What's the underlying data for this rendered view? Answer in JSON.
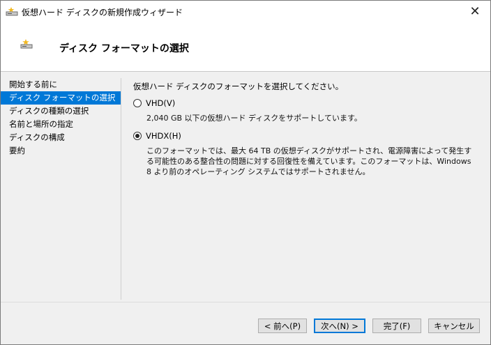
{
  "window": {
    "title": "仮想ハード ディスクの新規作成ウィザード",
    "close_glyph": "✕"
  },
  "header": {
    "title": "ディスク フォーマットの選択"
  },
  "nav": {
    "items": [
      {
        "label": "開始する前に",
        "active": false
      },
      {
        "label": "ディスク フォーマットの選択",
        "active": true
      },
      {
        "label": "ディスクの種類の選択",
        "active": false
      },
      {
        "label": "名前と場所の指定",
        "active": false
      },
      {
        "label": "ディスクの構成",
        "active": false
      },
      {
        "label": "要約",
        "active": false
      }
    ]
  },
  "content": {
    "intro": "仮想ハード ディスクのフォーマットを選択してください。",
    "options": [
      {
        "label": "VHD(V)",
        "checked": false,
        "description": "2,040 GB 以下の仮想ハード ディスクをサポートしています。"
      },
      {
        "label": "VHDX(H)",
        "checked": true,
        "description": "このフォーマットでは、最大 64 TB の仮想ディスクがサポートされ、電源障害によって発生する可能性のある整合性の問題に対する回復性を備えています。このフォーマットは、Windows 8 より前のオペレーティング システムではサポートされません。"
      }
    ]
  },
  "footer": {
    "back_label": "< 前へ(P)",
    "next_label": "次へ(N) >",
    "finish_label": "完了(F)",
    "cancel_label": "キャンセル"
  },
  "icons": {
    "title_icon": "virtual-disk-icon",
    "header_icon": "virtual-disk-icon"
  },
  "colors": {
    "accent": "#0078d7",
    "panel": "#f0f0f0"
  }
}
